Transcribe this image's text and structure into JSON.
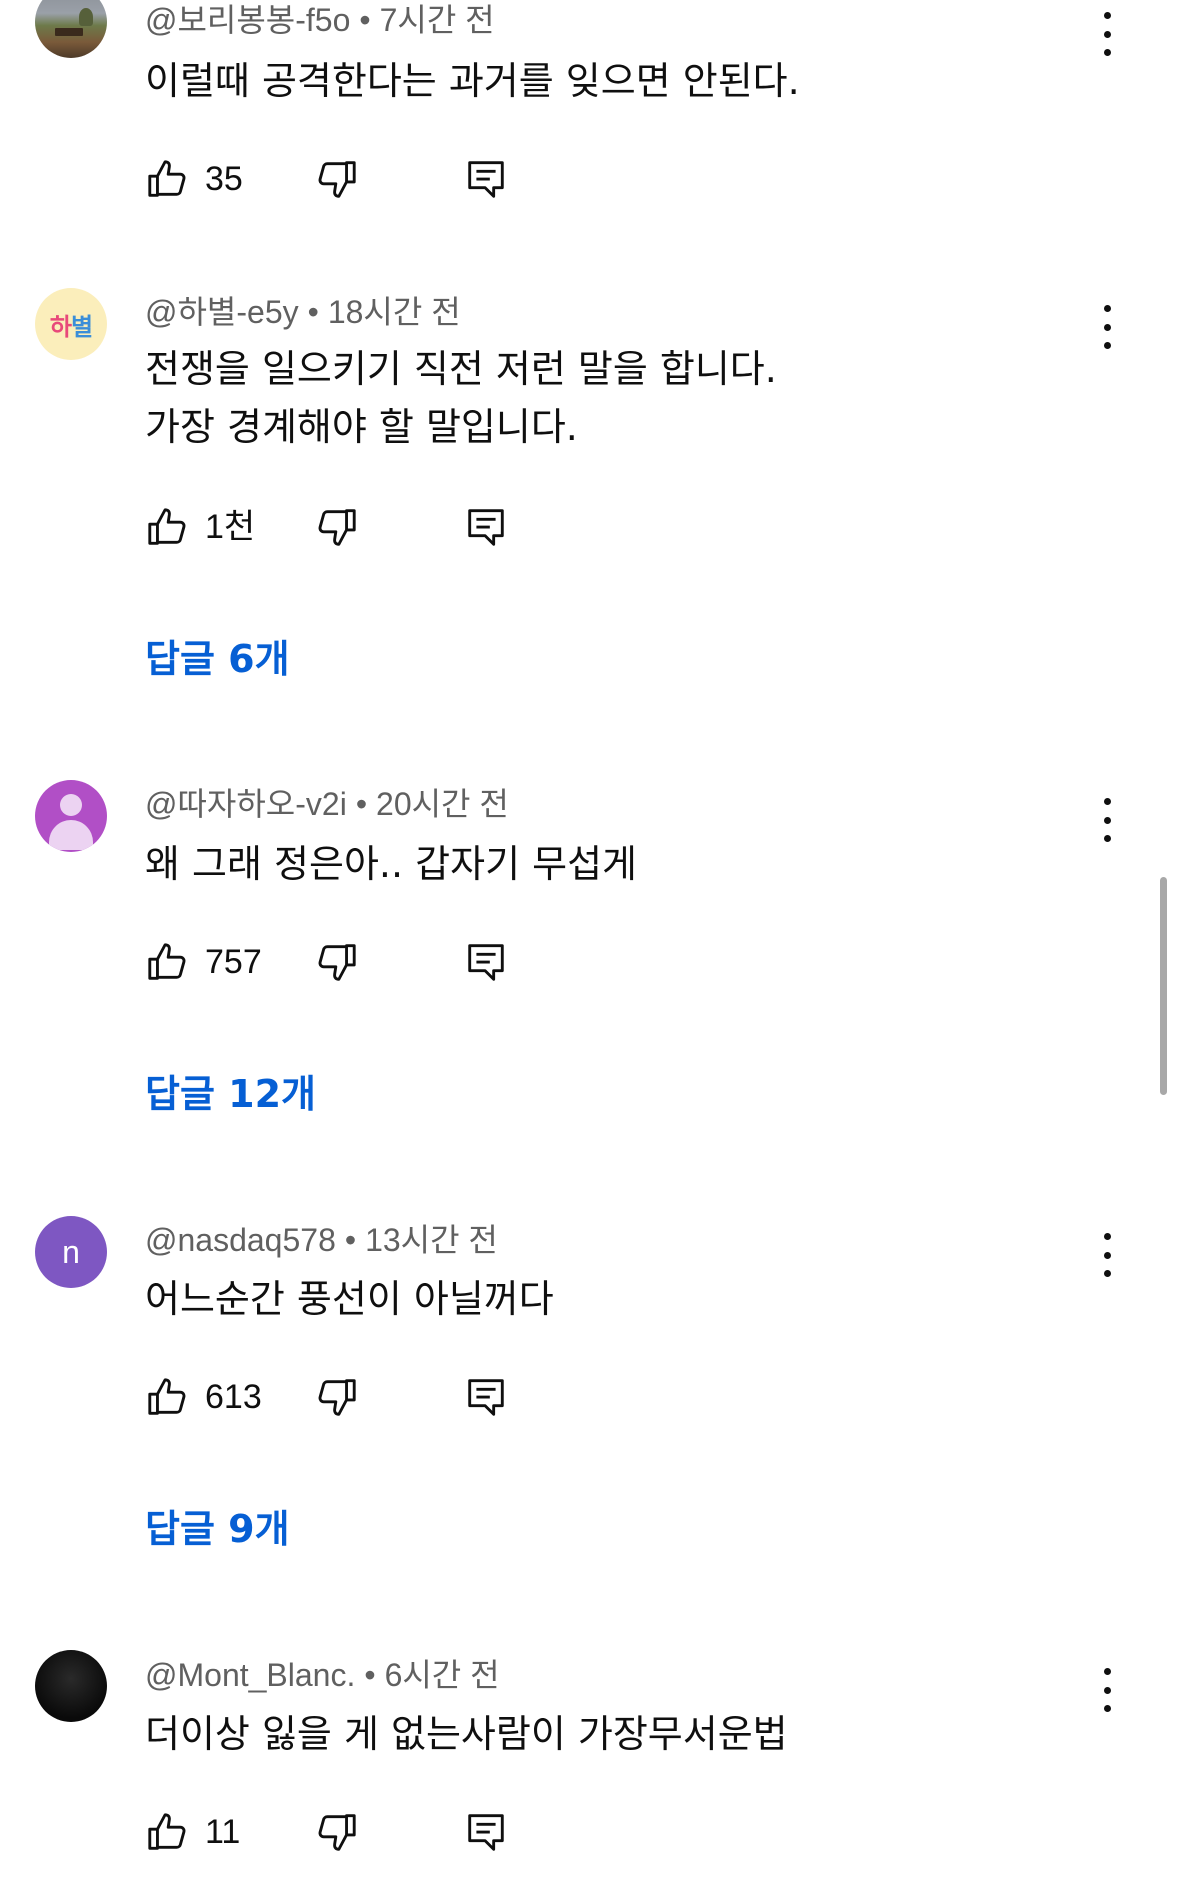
{
  "comments": [
    {
      "handle": "@보리봉봉-f5o",
      "time": "7시간 전",
      "lines": [
        "이럴때 공격한다는 과거를 잊으면 안된다."
      ],
      "likes": "35",
      "replies": null,
      "avatar": "photo-icon"
    },
    {
      "handle": "@하별-e5y",
      "time": "18시간 전",
      "lines": [
        "전쟁을 일으키기 직전 저런 말을 합니다.",
        "가장 경계해야 할 말입니다."
      ],
      "likes": "1천",
      "replies": "답글 6개",
      "avatar_text": [
        "하",
        "별"
      ]
    },
    {
      "handle": "@따자하오-v2i",
      "time": "20시간 전",
      "lines": [
        "왜 그래 정은아.. 갑자기 무섭게"
      ],
      "likes": "757",
      "replies": "답글 12개",
      "avatar": "default-person-icon"
    },
    {
      "handle": "@nasdaq578",
      "time": "13시간 전",
      "lines": [
        "어느순간 풍선이 아닐꺼다"
      ],
      "likes": "613",
      "replies": "답글 9개",
      "avatar_letter": "n"
    },
    {
      "handle": "@Mont_Blanc.",
      "time": "6시간 전",
      "lines": [
        "더이상 잃을 게 없는사람이 가장무서운법"
      ],
      "likes": "11",
      "replies": null,
      "avatar": "dark-photo-icon"
    }
  ],
  "separator": "•",
  "icons": {
    "like": "thumbs-up-icon",
    "dislike": "thumbs-down-icon",
    "reply": "reply-comment-icon",
    "more": "more-vert-icon"
  },
  "colors": {
    "link": "#065fd4",
    "text": "#0f0f0f",
    "meta": "#606060"
  }
}
